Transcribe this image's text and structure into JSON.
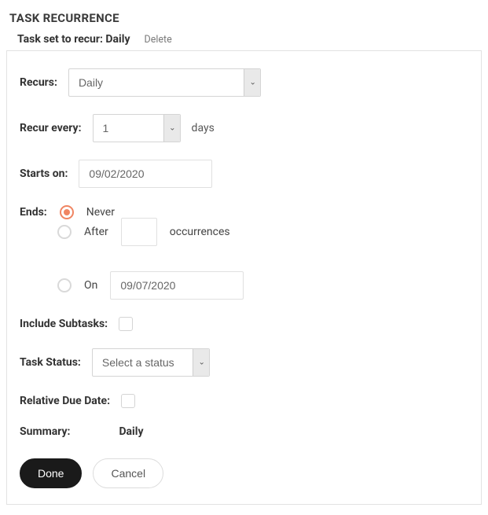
{
  "pageTitle": "TASK RECURRENCE",
  "subtitle": "Task set to recur: Daily",
  "deleteLabel": "Delete",
  "labels": {
    "recurs": "Recurs:",
    "recurEvery": "Recur every:",
    "daysSuffix": "days",
    "startsOn": "Starts on:",
    "ends": "Ends:",
    "includeSubtasks": "Include Subtasks:",
    "taskStatus": "Task Status:",
    "relativeDueDate": "Relative Due Date:",
    "summary": "Summary:"
  },
  "recurs": {
    "selected": "Daily"
  },
  "recurEvery": {
    "value": "1"
  },
  "startsOn": "09/02/2020",
  "ends": {
    "selected": "never",
    "options": {
      "never": "Never",
      "after": "After",
      "afterSuffix": "occurrences",
      "on": "On"
    },
    "afterCount": "",
    "onDate": "09/07/2020"
  },
  "includeSubtasks": false,
  "taskStatus": {
    "placeholder": "Select a status"
  },
  "relativeDueDate": false,
  "summaryValue": "Daily",
  "buttons": {
    "done": "Done",
    "cancel": "Cancel"
  }
}
